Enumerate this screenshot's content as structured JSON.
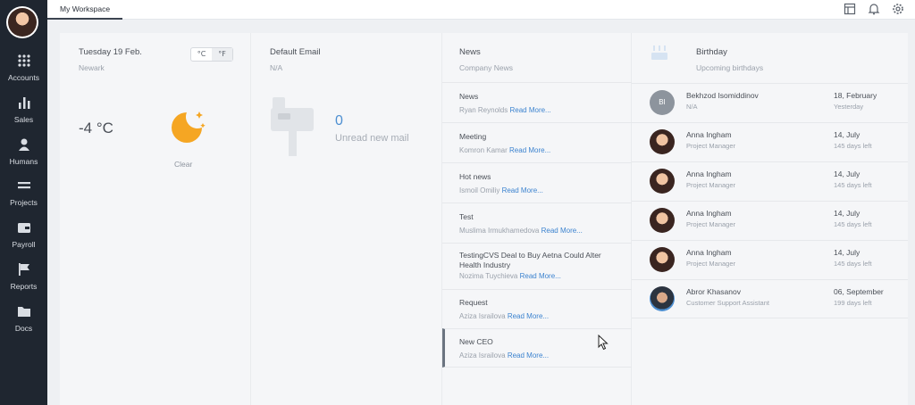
{
  "sidebar": {
    "items": [
      {
        "label": "Accounts",
        "icon": "grid-icon"
      },
      {
        "label": "Sales",
        "icon": "bar-chart-icon"
      },
      {
        "label": "Humans",
        "icon": "person-icon"
      },
      {
        "label": "Projects",
        "icon": "lines-icon"
      },
      {
        "label": "Payroll",
        "icon": "wallet-icon"
      },
      {
        "label": "Reports",
        "icon": "flag-icon"
      },
      {
        "label": "Docs",
        "icon": "folder-icon"
      }
    ]
  },
  "topbar": {
    "tab": "My Workspace",
    "icons": [
      "layout-icon",
      "bell-icon",
      "gear-icon"
    ]
  },
  "weather": {
    "date": "Tuesday 19 Feb.",
    "location": "Newark",
    "unit_c": "°C",
    "unit_f": "°F",
    "temperature": "-4 °C",
    "condition": "Clear"
  },
  "email": {
    "title": "Default Email",
    "sub": "N/A",
    "count": "0",
    "label": "Unread new mail"
  },
  "news": {
    "title": "News",
    "sub": "Company News",
    "read_more": "Read More...",
    "items": [
      {
        "title": "News",
        "author": "Ryan Reynolds"
      },
      {
        "title": "Meeting",
        "author": "Komron Kamar"
      },
      {
        "title": "Hot news",
        "author": "Ismoil Omiliy"
      },
      {
        "title": "Test",
        "author": "Muslima Irmukhamedova"
      },
      {
        "title": "TestingCVS Deal to Buy Aetna Could Alter Health Industry",
        "author": "Nozima Tuychieva"
      },
      {
        "title": "Request",
        "author": "Aziza Israilova"
      },
      {
        "title": "New CEO",
        "author": "Aziza Israilova"
      }
    ]
  },
  "birthday": {
    "title": "Birthday",
    "sub": "Upcoming birthdays",
    "people": [
      {
        "initials": "BI",
        "name": "Bekhzod Isomiddinov",
        "role": "N/A",
        "date": "18, February",
        "left": "Yesterday"
      },
      {
        "name": "Anna Ingham",
        "role": "Project Manager",
        "date": "14, July",
        "left": "145 days left"
      },
      {
        "name": "Anna Ingham",
        "role": "Project Manager",
        "date": "14, July",
        "left": "145 days left"
      },
      {
        "name": "Anna Ingham",
        "role": "Project Manager",
        "date": "14, July",
        "left": "145 days left"
      },
      {
        "name": "Anna Ingham",
        "role": "Project Manager",
        "date": "14, July",
        "left": "145 days left"
      },
      {
        "name": "Abror Khasanov",
        "role": "Customer Support Assistant",
        "date": "06, September",
        "left": "199 days left"
      }
    ]
  },
  "colors": {
    "sidebar": "#1f2630",
    "accent": "#3c83cf",
    "sun": "#f5a623"
  }
}
